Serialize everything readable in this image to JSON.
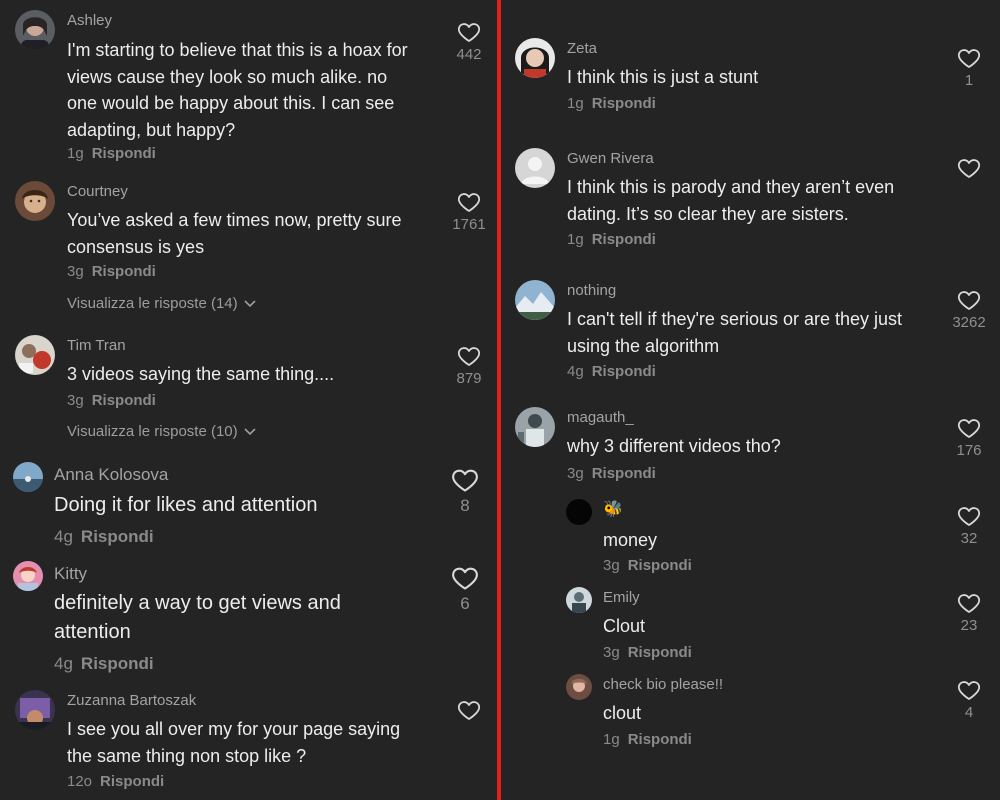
{
  "reply_label": "Rispondi",
  "left": {
    "comments": [
      {
        "username": "Ashley",
        "lines": [
          "I'm starting to believe that this is a hoax for",
          "views cause they look so much alike. no",
          "one would be happy about this. I can see",
          "adapting, but happy?"
        ],
        "age": "1g",
        "likes": "442"
      },
      {
        "username": "Courtney",
        "lines": [
          "You’ve asked a few times now, pretty sure",
          "consensus is yes"
        ],
        "age": "3g",
        "likes": "1761",
        "replies": "Visualizza le risposte (14)"
      },
      {
        "username": "Tim Tran",
        "lines": [
          "3 videos saying the same thing...."
        ],
        "age": "3g",
        "likes": "879",
        "replies": "Visualizza le risposte (10)"
      },
      {
        "username": "Anna Kolosova",
        "lines": [
          "Doing it for likes and attention"
        ],
        "age": "4g",
        "likes": "8"
      },
      {
        "username": "Kitty",
        "lines": [
          "definitely a way to get views and",
          "attention"
        ],
        "age": "4g",
        "likes": "6"
      },
      {
        "username": "Zuzanna Bartoszak",
        "lines": [
          "I see you all over my for your page saying",
          "the same thing non stop like ?"
        ],
        "age": "12o",
        "likes": ""
      }
    ]
  },
  "right": {
    "comments": [
      {
        "username": "Zeta",
        "lines": [
          "I think this is just a stunt"
        ],
        "age": "1g",
        "likes": "1"
      },
      {
        "username": "Gwen Rivera",
        "lines": [
          "I think this is parody and they aren’t even",
          "dating. It’s so clear they are sisters."
        ],
        "age": "1g",
        "likes": ""
      },
      {
        "username": "nothing",
        "lines": [
          "I can't tell if they're serious or are they just",
          "using the algorithm"
        ],
        "age": "4g",
        "likes": "3262"
      },
      {
        "username": "magauth_",
        "lines": [
          "why 3 different videos tho?"
        ],
        "age": "3g",
        "likes": "176"
      }
    ],
    "replies": [
      {
        "username": "🐝",
        "lines": [
          "money"
        ],
        "age": "3g",
        "likes": "32"
      },
      {
        "username": "Emily",
        "lines": [
          "Clout"
        ],
        "age": "3g",
        "likes": "23"
      },
      {
        "username": "check bio please!!",
        "lines": [
          "clout"
        ],
        "age": "1g",
        "likes": "4"
      }
    ]
  },
  "colors": {
    "background": "#242424",
    "divider": "#e51e1e",
    "text": "#ededed",
    "muted": "#8a8a8a"
  }
}
